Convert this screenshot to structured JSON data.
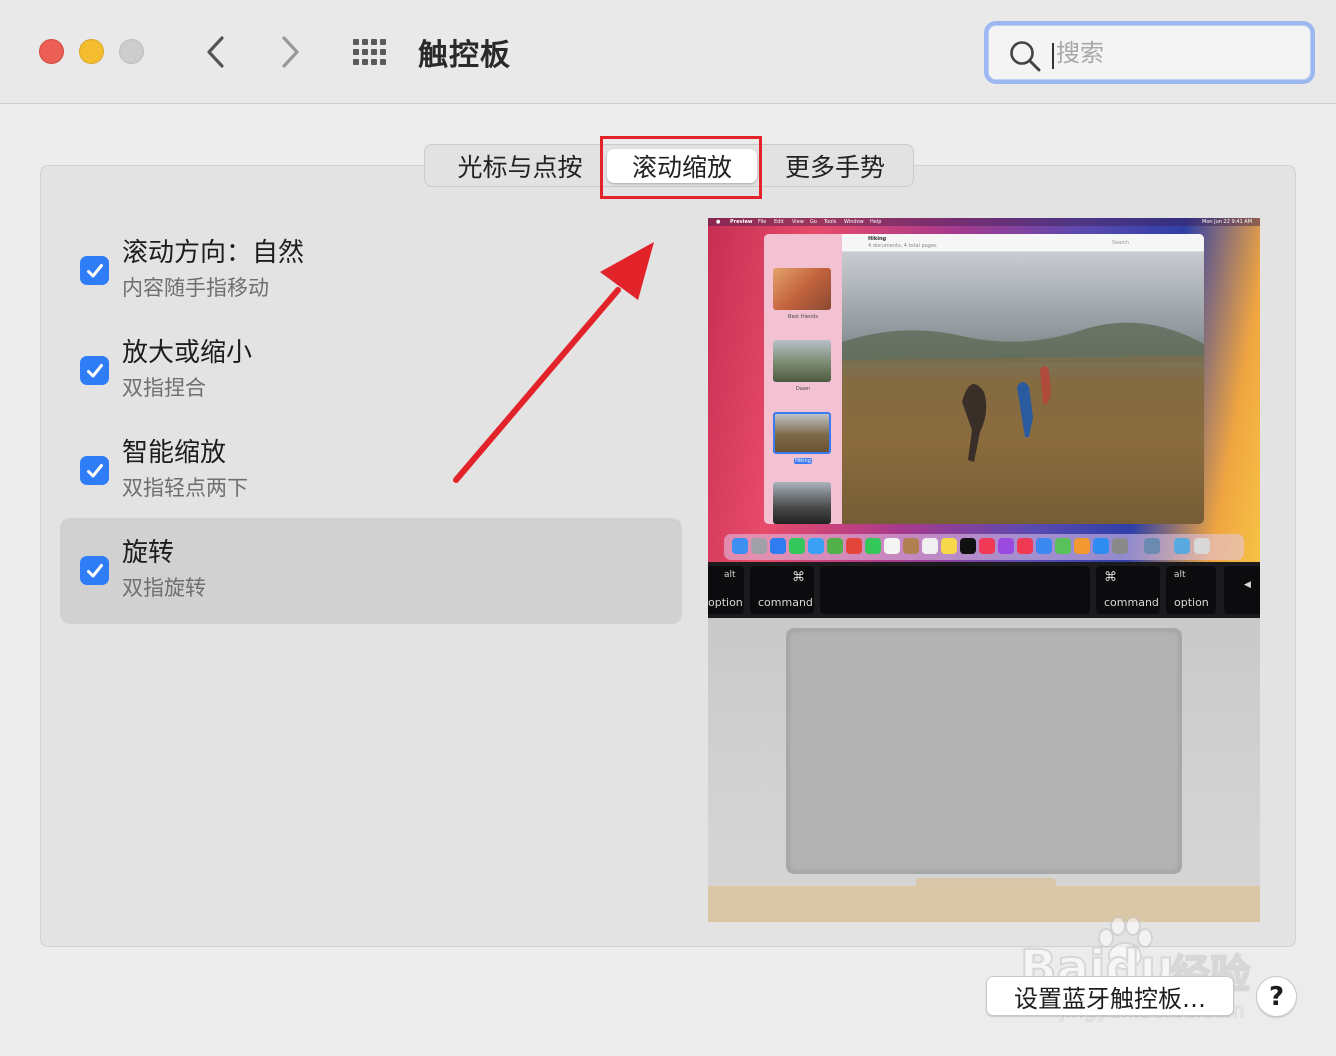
{
  "window": {
    "title": "触控板",
    "traffic_lights": [
      "close-red",
      "minimize-yellow",
      "zoom-disabled-gray"
    ]
  },
  "toolbar": {
    "back_icon": "chevron-left-icon",
    "forward_icon": "chevron-right-icon",
    "grid_icon": "show-all-grid-icon"
  },
  "search": {
    "placeholder": "搜索",
    "value": ""
  },
  "tabs": [
    {
      "label": "光标与点按",
      "selected": false
    },
    {
      "label": "滚动缩放",
      "selected": true
    },
    {
      "label": "更多手势",
      "selected": false
    }
  ],
  "options": [
    {
      "title": "滚动方向：自然",
      "description": "内容随手指移动",
      "checked": true,
      "selected": false
    },
    {
      "title": "放大或缩小",
      "description": "双指捏合",
      "checked": true,
      "selected": false
    },
    {
      "title": "智能缩放",
      "description": "双指轻点两下",
      "checked": true,
      "selected": false
    },
    {
      "title": "旋转",
      "description": "双指旋转",
      "checked": true,
      "selected": true
    }
  ],
  "preview": {
    "menubar": [
      "Preview",
      "File",
      "Edit",
      "View",
      "Go",
      "Tools",
      "Window",
      "Help"
    ],
    "clock": "Mon Jun 22  9:41 AM",
    "doc_title": "Hiking",
    "doc_subtitle": "4 documents, 4 total pages",
    "search_label": "Search",
    "thumb_labels": [
      "Best friends",
      "Dawn",
      "Hiking"
    ],
    "keys": [
      {
        "top": "alt",
        "bottom": "option"
      },
      {
        "top": "⌘",
        "bottom": "command"
      },
      {
        "top": "",
        "bottom": ""
      },
      {
        "top": "⌘",
        "bottom": "command"
      },
      {
        "top": "alt",
        "bottom": "option"
      },
      {
        "top": "◀",
        "bottom": ""
      }
    ]
  },
  "footer": {
    "setup_button": "设置蓝牙触控板…",
    "help_button": "?"
  },
  "watermark": {
    "brand": "Baidu",
    "suffix": "经验",
    "url": "jingyan.baidu.com"
  },
  "colors": {
    "accent": "#2e7cf6",
    "annotation_red": "#e2232a",
    "search_focus": "#9db8f0"
  }
}
